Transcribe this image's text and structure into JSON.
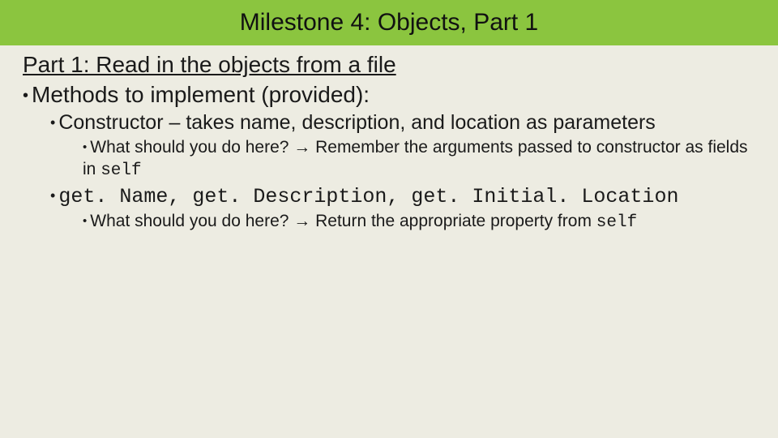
{
  "title": "Milestone 4: Objects, Part 1",
  "heading": "Part 1: Read in the objects from a file",
  "l1_methods": "Methods to implement (provided):",
  "l2_constructor": "Constructor – takes name, description, and location as parameters",
  "l3_constructor_hint_pre": "What should you do here? → Remember the arguments passed to constructor as fields in ",
  "l3_constructor_hint_code": "self",
  "l2_getters_pre": "get. Name, ",
  "l2_getters_mid": "get. Description, ",
  "l2_getters_end": "get. Initial. Location",
  "l3_getters_hint_pre": "What should you do here? → Return the appropriate property from ",
  "l3_getters_hint_code": "self"
}
